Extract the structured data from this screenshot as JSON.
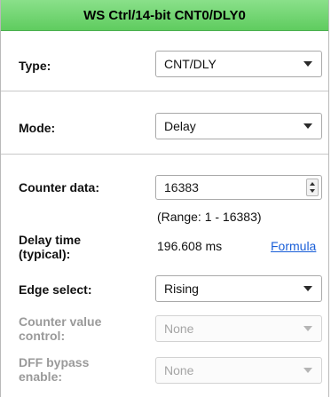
{
  "header": {
    "title": "WS Ctrl/14-bit CNT0/DLY0"
  },
  "type": {
    "label": "Type:",
    "value": "CNT/DLY"
  },
  "mode": {
    "label": "Mode:",
    "value": "Delay"
  },
  "counter": {
    "label": "Counter data:",
    "value": "16383",
    "range": "(Range:  1 - 16383)"
  },
  "delay": {
    "label_line1": "Delay time",
    "label_line2": "(typical):",
    "value": "196.608 ms",
    "formula_link": "Formula"
  },
  "edge": {
    "label": "Edge select:",
    "value": "Rising"
  },
  "counter_value_control": {
    "label_line1": "Counter value",
    "label_line2": "control:",
    "value": "None"
  },
  "dff_bypass": {
    "label_line1": "DFF bypass",
    "label_line2": "enable:",
    "value": "None"
  },
  "colors": {
    "header_bg": "#6ad66a",
    "link": "#1a5fd8",
    "disabled_text": "#9a9a9a"
  },
  "icons": {
    "dropdown": "chevron-down-icon",
    "spin": "spin-arrows-icon"
  }
}
